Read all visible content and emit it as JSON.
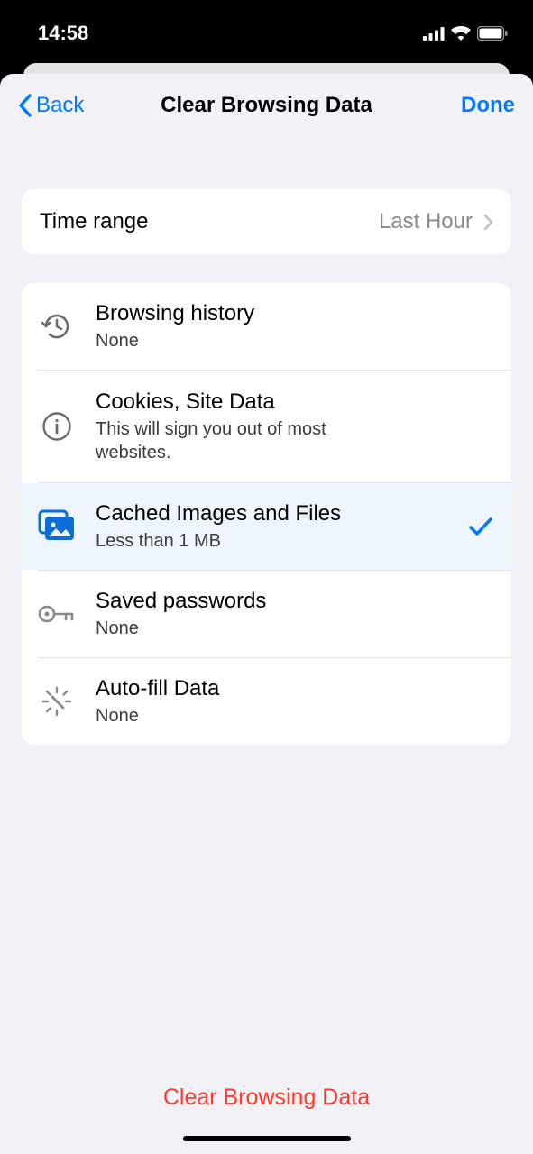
{
  "status": {
    "time": "14:58"
  },
  "nav": {
    "back_label": "Back",
    "title": "Clear Browsing Data",
    "done_label": "Done"
  },
  "time_range": {
    "label": "Time range",
    "value": "Last Hour"
  },
  "options": [
    {
      "title": "Browsing history",
      "subtitle": "None",
      "selected": false
    },
    {
      "title": "Cookies, Site Data",
      "subtitle": "This will sign you out of most websites.",
      "selected": false
    },
    {
      "title": "Cached Images and Files",
      "subtitle": "Less than 1 MB",
      "selected": true
    },
    {
      "title": "Saved passwords",
      "subtitle": "None",
      "selected": false
    },
    {
      "title": "Auto-fill Data",
      "subtitle": "None",
      "selected": false
    }
  ],
  "footer": {
    "clear_label": "Clear Browsing Data"
  }
}
